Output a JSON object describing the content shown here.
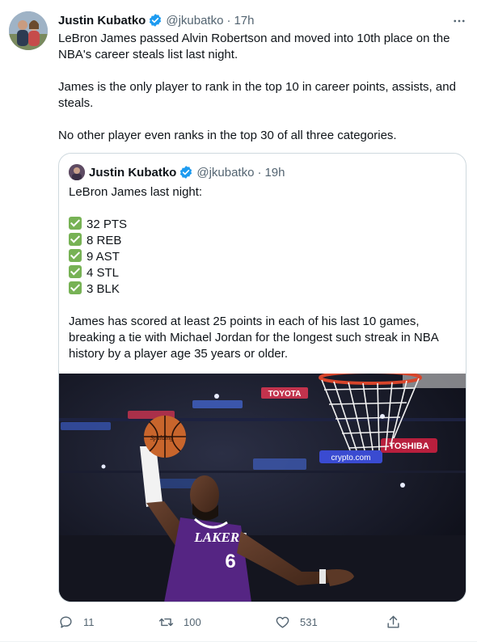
{
  "tweet": {
    "author_name": "Justin Kubatko",
    "handle": "@jkubatko",
    "separator": "·",
    "time": "17h",
    "paragraphs": [
      "LeBron James passed Alvin Robertson and moved into 10th place on the NBA's career steals list last night.",
      "James is the only player to rank in the top 10 in career points, assists, and steals.",
      "No other player even ranks in the top 30 of all three categories."
    ],
    "icons": {
      "avatar": "avatar-photo",
      "verified": "verified-badge-icon",
      "more": "more-icon"
    }
  },
  "quote": {
    "author_name": "Justin Kubatko",
    "handle": "@jkubatko",
    "separator": "·",
    "time": "19h",
    "intro": "LeBron James last night:",
    "stats": [
      "32 PTS",
      "8 REB",
      "9 AST",
      "4 STL",
      "3 BLK"
    ],
    "body": "James has scored at least 25 points in each of his last 10 games, breaking a tie with Michael Jordan for the longest such streak in NBA history by a player age 35 years or older.",
    "image": {
      "jersey_text": "LAKERS",
      "jersey_number": "6",
      "ball_text": "Spalding",
      "arena_signs": [
        "TOYOTA",
        "crypto.com",
        "TOSHIBA"
      ]
    }
  },
  "actions": {
    "reply_count": "11",
    "retweet_count": "100",
    "like_count": "531"
  },
  "colors": {
    "text": "#0f1419",
    "secondary": "#536471",
    "verified": "#1d9bf0",
    "border": "#cfd9de",
    "lakers_purple": "#552583",
    "check_green": "#77b255"
  }
}
